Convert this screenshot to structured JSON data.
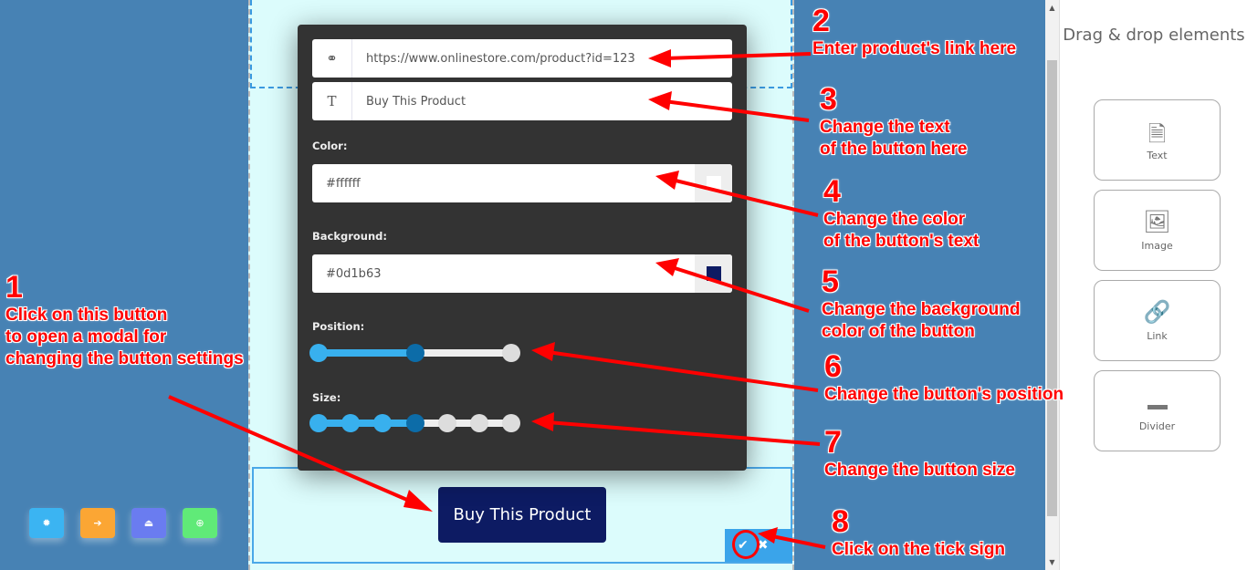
{
  "modal": {
    "link_icon": "link-icon",
    "link_value": "https://www.onlinestore.com/product?id=123",
    "text_icon": "text-icon",
    "text_value": "Buy This Product",
    "color_label": "Color:",
    "color_value": "#ffffff",
    "background_label": "Background:",
    "background_value": "#0d1b63",
    "position_label": "Position:",
    "position_steps": 3,
    "position_selected": 2,
    "size_label": "Size:",
    "size_steps": 7,
    "size_selected": 4
  },
  "preview_button": {
    "label": "Buy This Product",
    "background": "#0d1b63",
    "color": "#ffffff"
  },
  "actions": {
    "confirm_icon": "check-icon",
    "cancel_icon": "close-icon"
  },
  "toolbar": [
    {
      "icon": "gear-icon",
      "color": "#3bb4f2"
    },
    {
      "icon": "export-icon",
      "color": "#fba634"
    },
    {
      "icon": "save-icon",
      "color": "#6a7cf0"
    },
    {
      "icon": "zoom-icon",
      "color": "#60ea78"
    }
  ],
  "panel": {
    "title": "Drag & drop elements",
    "items": [
      {
        "label": "Text",
        "icon": "file-text-icon"
      },
      {
        "label": "Image",
        "icon": "image-icon"
      },
      {
        "label": "Link",
        "icon": "link-icon"
      },
      {
        "label": "Divider",
        "icon": "divider-icon"
      }
    ]
  },
  "annotations": [
    {
      "n": "1",
      "text": "Click on this button\nto open a modal for\nchanging the button settings"
    },
    {
      "n": "2",
      "text": "Enter product's link here"
    },
    {
      "n": "3",
      "text": "Change the text\nof the button here"
    },
    {
      "n": "4",
      "text": "Change the color\nof the button's text"
    },
    {
      "n": "5",
      "text": "Change the background\ncolor of the button"
    },
    {
      "n": "6",
      "text": "Change the button's position"
    },
    {
      "n": "7",
      "text": "Change the button size"
    },
    {
      "n": "8",
      "text": "Click on the tick sign"
    }
  ]
}
